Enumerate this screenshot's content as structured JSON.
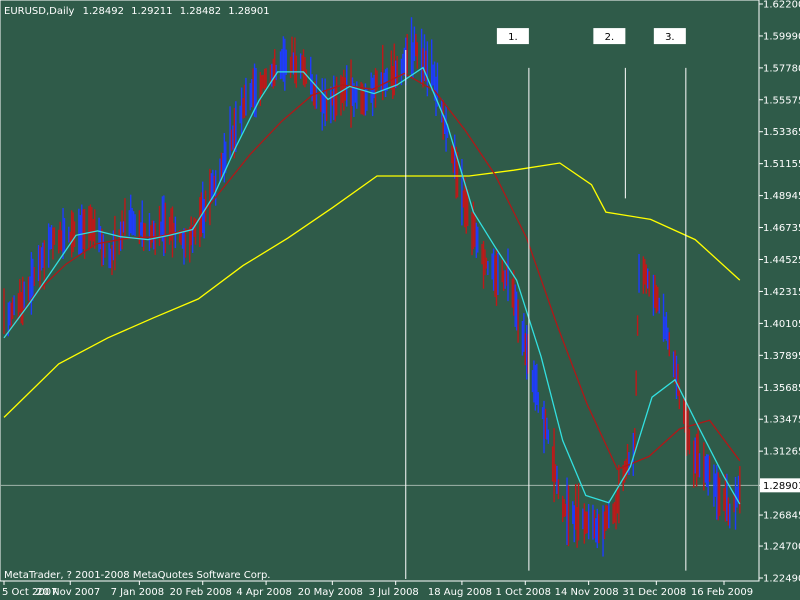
{
  "chart_data": {
    "type": "line",
    "header": {
      "symbol": "EURUSD,Daily",
      "open": "1.28492",
      "high": "1.29211",
      "low": "1.28482",
      "close": "1.28901"
    },
    "copyright": "MetaTrader, ? 2001-2008 MetaQuotes Software Corp.",
    "x_axis_dates": [
      "5 Oct 2007",
      "20 Nov 2007",
      "7 Jan 2008",
      "20 Feb 2008",
      "4 Apr 2008",
      "20 May 2008",
      "3 Jul 2008",
      "18 Aug 2008",
      "1 Oct 2008",
      "14 Nov 2008",
      "31 Dec 2008",
      "16 Feb 2009"
    ],
    "y_ticks": [
      "1.62200",
      "1.59990",
      "1.57780",
      "1.55575",
      "1.53365",
      "1.51155",
      "1.48945",
      "1.46735",
      "1.44525",
      "1.42315",
      "1.40105",
      "1.37895",
      "1.35685",
      "1.33475",
      "1.31265",
      "1.28901",
      "1.26845",
      "1.24700",
      "1.22490"
    ],
    "ylim": [
      1.2249,
      1.622
    ],
    "current_price": 1.28901,
    "annotations": [
      {
        "label": "1.",
        "date": "2008-09-21",
        "price": 1.5998,
        "line_from": 1.5778,
        "line_to": 1.23
      },
      {
        "label": "2.",
        "date": "2008-11-27",
        "price": 1.5998,
        "line_from": 1.5778,
        "line_to": 1.4875
      },
      {
        "label": "3.",
        "date": "2009-01-08",
        "price": 1.5998,
        "line_from": 1.5778,
        "line_to": 1.23
      }
    ],
    "vertical_marker_date": "2008-07-10",
    "series": [
      {
        "color": "#ffff00",
        "points": [
          [
            "2007-10-05",
            1.336
          ],
          [
            "2007-11-12",
            1.373
          ],
          [
            "2007-12-16",
            1.391
          ],
          [
            "2008-01-17",
            1.405
          ],
          [
            "2008-02-17",
            1.418
          ],
          [
            "2008-03-19",
            1.441
          ],
          [
            "2008-04-19",
            1.46
          ],
          [
            "2008-05-20",
            1.481
          ],
          [
            "2008-06-20",
            1.503
          ],
          [
            "2008-07-23",
            1.503
          ],
          [
            "2008-08-23",
            1.503
          ],
          [
            "2008-09-23",
            1.507
          ],
          [
            "2008-10-25",
            1.512
          ],
          [
            "2008-11-16",
            1.497
          ],
          [
            "2008-11-26",
            1.478
          ],
          [
            "2008-12-27",
            1.473
          ],
          [
            "2009-01-27",
            1.459
          ],
          [
            "2009-02-27",
            1.431
          ]
        ]
      },
      {
        "color": "#b01818",
        "points": [
          [
            "2007-10-05",
            1.391
          ],
          [
            "2007-10-27",
            1.422
          ],
          [
            "2007-11-17",
            1.442
          ],
          [
            "2007-12-08",
            1.456
          ],
          [
            "2007-12-30",
            1.46
          ],
          [
            "2008-01-20",
            1.461
          ],
          [
            "2008-02-11",
            1.466
          ],
          [
            "2008-03-03",
            1.492
          ],
          [
            "2008-03-24",
            1.518
          ],
          [
            "2008-04-15",
            1.541
          ],
          [
            "2008-05-06",
            1.559
          ],
          [
            "2008-05-27",
            1.566
          ],
          [
            "2008-06-17",
            1.563
          ],
          [
            "2008-07-09",
            1.574
          ],
          [
            "2008-07-30",
            1.562
          ],
          [
            "2008-08-20",
            1.535
          ],
          [
            "2008-09-10",
            1.504
          ],
          [
            "2008-10-02",
            1.46
          ],
          [
            "2008-10-23",
            1.4
          ],
          [
            "2008-11-13",
            1.345
          ],
          [
            "2008-12-04",
            1.3
          ],
          [
            "2008-12-26",
            1.309
          ],
          [
            "2009-01-16",
            1.328
          ],
          [
            "2009-02-06",
            1.334
          ],
          [
            "2009-02-27",
            1.306
          ]
        ]
      },
      {
        "color": "#32e0e0",
        "points": [
          [
            "2007-10-05",
            1.391
          ],
          [
            "2007-10-22",
            1.414
          ],
          [
            "2007-11-07",
            1.437
          ],
          [
            "2007-11-24",
            1.462
          ],
          [
            "2007-12-09",
            1.465
          ],
          [
            "2007-12-25",
            1.461
          ],
          [
            "2008-01-13",
            1.459
          ],
          [
            "2008-01-28",
            1.462
          ],
          [
            "2008-02-13",
            1.466
          ],
          [
            "2008-02-28",
            1.49
          ],
          [
            "2008-03-14",
            1.523
          ],
          [
            "2008-03-30",
            1.555
          ],
          [
            "2008-04-12",
            1.575
          ],
          [
            "2008-04-30",
            1.575
          ],
          [
            "2008-05-17",
            1.556
          ],
          [
            "2008-06-01",
            1.565
          ],
          [
            "2008-06-18",
            1.56
          ],
          [
            "2008-07-04",
            1.566
          ],
          [
            "2008-07-22",
            1.578
          ],
          [
            "2008-08-08",
            1.538
          ],
          [
            "2008-08-26",
            1.478
          ],
          [
            "2008-09-10",
            1.454
          ],
          [
            "2008-09-25",
            1.431
          ],
          [
            "2008-10-12",
            1.378
          ],
          [
            "2008-10-27",
            1.32
          ],
          [
            "2008-11-12",
            1.282
          ],
          [
            "2008-11-28",
            1.277
          ],
          [
            "2008-12-13",
            1.302
          ],
          [
            "2008-12-28",
            1.35
          ],
          [
            "2009-01-13",
            1.362
          ],
          [
            "2009-01-29",
            1.33
          ],
          [
            "2009-02-16",
            1.295
          ],
          [
            "2009-02-27",
            1.276
          ]
        ]
      }
    ],
    "price_path": [
      [
        "2007-10-05",
        1.402
      ],
      [
        "2007-10-22",
        1.424
      ],
      [
        "2007-11-07",
        1.459
      ],
      [
        "2007-11-24",
        1.462
      ],
      [
        "2007-12-07",
        1.466
      ],
      [
        "2007-12-18",
        1.445
      ],
      [
        "2007-12-30",
        1.475
      ],
      [
        "2008-01-13",
        1.463
      ],
      [
        "2008-01-28",
        1.469
      ],
      [
        "2008-02-09",
        1.454
      ],
      [
        "2008-02-20",
        1.478
      ],
      [
        "2008-03-06",
        1.514
      ],
      [
        "2008-03-21",
        1.558
      ],
      [
        "2008-04-03",
        1.569
      ],
      [
        "2008-04-18",
        1.583
      ],
      [
        "2008-04-29",
        1.578
      ],
      [
        "2008-05-14",
        1.551
      ],
      [
        "2008-05-29",
        1.565
      ],
      [
        "2008-06-10",
        1.554
      ],
      [
        "2008-06-21",
        1.568
      ],
      [
        "2008-07-05",
        1.574
      ],
      [
        "2008-07-16",
        1.591
      ],
      [
        "2008-07-27",
        1.577
      ],
      [
        "2008-08-08",
        1.533
      ],
      [
        "2008-08-22",
        1.476
      ],
      [
        "2008-09-05",
        1.44
      ],
      [
        "2008-09-20",
        1.432
      ],
      [
        "2008-10-03",
        1.375
      ],
      [
        "2008-10-16",
        1.327
      ],
      [
        "2008-10-27",
        1.273
      ],
      [
        "2008-11-07",
        1.267
      ],
      [
        "2008-11-21",
        1.259
      ],
      [
        "2008-12-02",
        1.271
      ],
      [
        "2008-12-16",
        1.32
      ],
      [
        "2008-12-19",
        1.44
      ],
      [
        "2008-12-30",
        1.424
      ],
      [
        "2009-01-10",
        1.383
      ],
      [
        "2009-01-24",
        1.315
      ],
      [
        "2009-02-07",
        1.295
      ],
      [
        "2009-02-21",
        1.269
      ],
      [
        "2009-02-27",
        1.289
      ]
    ]
  }
}
